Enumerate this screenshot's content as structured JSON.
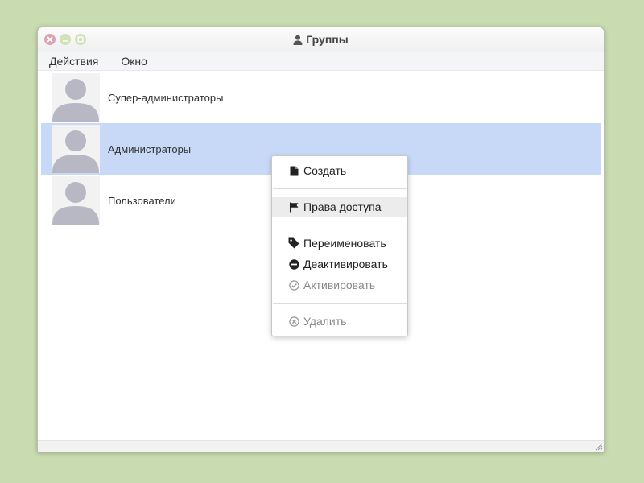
{
  "window": {
    "title": "Группы"
  },
  "menubar": {
    "actions": "Действия",
    "window": "Окно"
  },
  "groups": [
    {
      "label": "Супер-администраторы",
      "selected": false
    },
    {
      "label": "Администраторы",
      "selected": true
    },
    {
      "label": "Пользователи",
      "selected": false
    }
  ],
  "context_menu": {
    "create": "Создать",
    "permissions": "Права доступа",
    "rename": "Переименовать",
    "deactivate": "Деактивировать",
    "activate": "Активировать",
    "delete": "Удалить"
  },
  "colors": {
    "desktop": "#c9dbb0",
    "selection": "#c8d9f8",
    "close_button": "#d9a5b3",
    "window_buttons": "#cfe2b8",
    "avatar_silhouette": "#b7b8c4"
  },
  "icons": {
    "title": "user-icon",
    "create": "file-icon",
    "permissions": "flag-icon",
    "rename": "tag-icon",
    "deactivate": "minus-circle-icon",
    "activate": "check-circle-icon",
    "delete": "x-circle-icon"
  }
}
